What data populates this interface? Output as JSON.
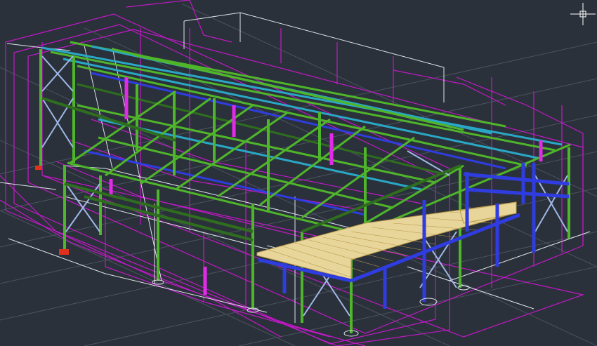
{
  "viewport": {
    "background": "#2b313a",
    "description_colors": {
      "grid": "#4a5360",
      "wireframe_white": "#dfe4ea",
      "magenta": "#c218c8",
      "green": "#4fb52a",
      "dark_green": "#2e6e1e",
      "blue": "#2f3ce0",
      "cyan": "#29a8c6",
      "deck": "#e8d59a",
      "red": "#e0311c"
    }
  },
  "icons": {
    "crosshair": "ucs-crosshair-icon"
  }
}
